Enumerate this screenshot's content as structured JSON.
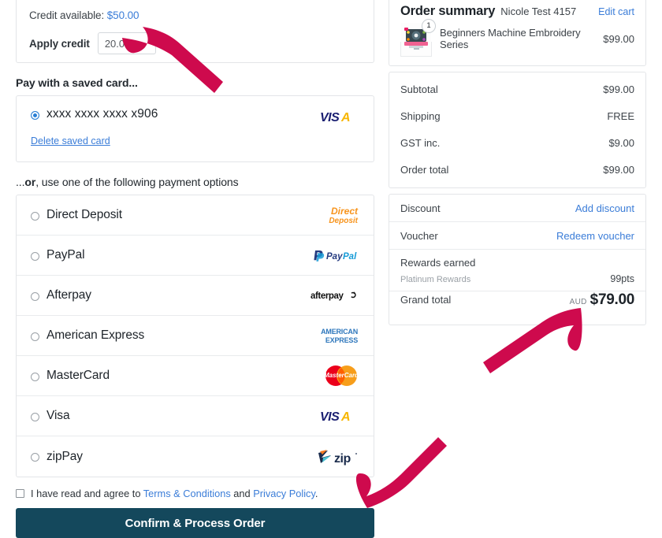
{
  "colors": {
    "annotation_arrow": "#CE0A4D",
    "link_blue": "#3b7dd8",
    "primary_button": "#14485c",
    "visa_blue": "#1A1F71",
    "visa_gold": "#F7B600",
    "paypal_dark": "#253B80",
    "paypal_light": "#179BD7",
    "amex_blue": "#2E77BC",
    "mastercard_red": "#EB001B",
    "mastercard_orange": "#F79E1B",
    "direct_deposit_orange": "#F7941D",
    "zip_navy": "#1A2B4C",
    "zip_orange": "#F47B20",
    "zip_teal": "#4AC3D4"
  },
  "credit": {
    "available_label": "Credit available:",
    "available_amount": "$50.00",
    "apply_label": "Apply credit",
    "apply_value": "20.00",
    "apply_placeholder": "0.00"
  },
  "saved_card": {
    "heading": "Pay with a saved card...",
    "number": "xxxx xxxx xxxx x906",
    "selected": true,
    "brand_logo": "visa-logo",
    "delete_link": "Delete saved card"
  },
  "other_payments": {
    "heading_prefix": "...",
    "heading_bold": "or",
    "heading_suffix": ", use one of the following payment options",
    "options": [
      {
        "label": "Direct Deposit",
        "logo": "direct-deposit-logo",
        "selected": false
      },
      {
        "label": "PayPal",
        "logo": "paypal-logo",
        "selected": false
      },
      {
        "label": "Afterpay",
        "logo": "afterpay-logo",
        "selected": false
      },
      {
        "label": "American Express",
        "logo": "american-express-logo",
        "selected": false
      },
      {
        "label": "MasterCard",
        "logo": "mastercard-logo",
        "selected": false
      },
      {
        "label": "Visa",
        "logo": "visa-logo",
        "selected": false
      },
      {
        "label": "zipPay",
        "logo": "zippay-logo",
        "selected": false
      }
    ]
  },
  "terms": {
    "checked": false,
    "text_before": "I have read and agree to ",
    "link1": "Terms & Conditions",
    "text_between": " and ",
    "link2": "Privacy Policy",
    "text_after": "."
  },
  "confirm_button": {
    "label": "Confirm & Process Order"
  },
  "order_summary": {
    "title": "Order summary",
    "customer": "Nicole Test 4157",
    "edit_cart": "Edit cart",
    "items": [
      {
        "name": "Beginners Machine Embroidery Series",
        "price": "$99.00",
        "qty": "1",
        "thumbnail": "embroidery-machine-thumbnail"
      }
    ],
    "totals": [
      {
        "label": "Subtotal",
        "value": "$99.00"
      },
      {
        "label": "Shipping",
        "value": "FREE"
      },
      {
        "label": "GST inc.",
        "value": "$9.00"
      },
      {
        "label": "Order total",
        "value": "$99.00"
      }
    ],
    "extras": [
      {
        "label": "Discount",
        "action": "Add discount"
      },
      {
        "label": "Voucher",
        "action": "Redeem voucher"
      }
    ],
    "rewards": {
      "title": "Rewards earned",
      "tier": "Platinum Rewards",
      "points": "99pts"
    },
    "grand_total": {
      "label": "Grand total",
      "currency": "AUD",
      "amount": "$79.00"
    }
  }
}
